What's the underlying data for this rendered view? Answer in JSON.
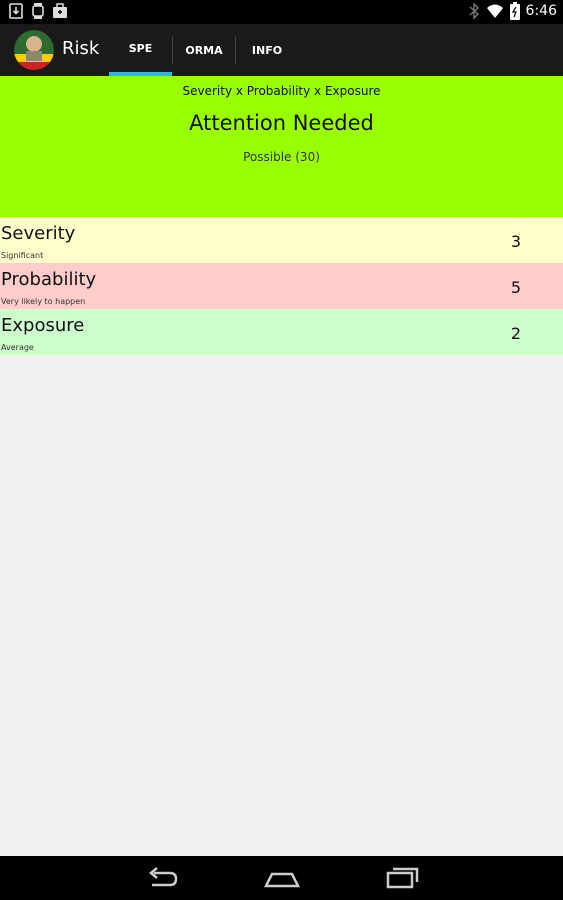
{
  "status_bar": {
    "time": "6:46",
    "left_icons": [
      "download-icon",
      "watch-icon",
      "bag-icon"
    ],
    "right_icons": [
      "bluetooth-icon",
      "wifi-icon",
      "battery-icon"
    ]
  },
  "action_bar": {
    "title": "Risk",
    "tabs": [
      {
        "label": "SPE",
        "active": true
      },
      {
        "label": "ORMA",
        "active": false
      },
      {
        "label": "INFO",
        "active": false
      }
    ],
    "accent": "#33b5e5"
  },
  "summary": {
    "formula": "Severity x Probability x Exposure",
    "status": "Attention Needed",
    "score_text": "Possible (30)",
    "color": "#99ff00"
  },
  "factors": [
    {
      "label": "Severity",
      "sub": "Significant",
      "value": "3",
      "color": "#ffffcc"
    },
    {
      "label": "Probability",
      "sub": "Very likely to happen",
      "value": "5",
      "color": "#ffcccc"
    },
    {
      "label": "Exposure",
      "sub": "Average",
      "value": "2",
      "color": "#ccffcc"
    }
  ],
  "nav": [
    "back-icon",
    "home-icon",
    "recent-apps-icon"
  ]
}
